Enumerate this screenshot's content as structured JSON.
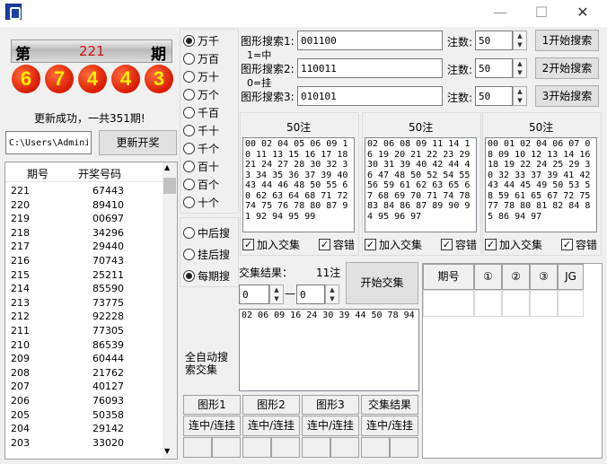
{
  "window": {
    "minimize": "—",
    "maximize": "☐",
    "close": "✕"
  },
  "header": {
    "prefix": "第",
    "issue": "221",
    "suffix": "期"
  },
  "balls": [
    "6",
    "7",
    "4",
    "4",
    "3"
  ],
  "update_status": "更新成功，一共351期!",
  "path_value": "C:\\Users\\Admini:",
  "update_button": "更新开奖",
  "history": {
    "headers": [
      "期号",
      "开奖号码"
    ],
    "rows": [
      [
        "221",
        "67443"
      ],
      [
        "220",
        "89410"
      ],
      [
        "219",
        "00697"
      ],
      [
        "218",
        "34296"
      ],
      [
        "217",
        "29440"
      ],
      [
        "216",
        "70743"
      ],
      [
        "215",
        "25211"
      ],
      [
        "214",
        "85590"
      ],
      [
        "213",
        "73775"
      ],
      [
        "212",
        "92228"
      ],
      [
        "211",
        "77305"
      ],
      [
        "210",
        "86539"
      ],
      [
        "209",
        "60444"
      ],
      [
        "208",
        "21762"
      ],
      [
        "207",
        "40127"
      ],
      [
        "206",
        "76093"
      ],
      [
        "205",
        "50358"
      ],
      [
        "204",
        "29142"
      ],
      [
        "203",
        "33020"
      ]
    ]
  },
  "positions": {
    "options": [
      "万千",
      "万百",
      "万十",
      "万个",
      "千百",
      "千十",
      "千个",
      "百十",
      "百个",
      "十个"
    ],
    "selected": 0
  },
  "search_mode": {
    "options": [
      "中后搜",
      "挂后搜",
      "每期搜"
    ],
    "selected": 2
  },
  "patterns": [
    {
      "label": "图形搜索1:",
      "value": "001100",
      "count_label": "注数:",
      "count": "50",
      "button": "1开始搜索"
    },
    {
      "label": "图形搜索2:",
      "value": "110011",
      "count_label": "注数:",
      "count": "50",
      "button": "2开始搜索"
    },
    {
      "label": "图形搜索3:",
      "value": "010101",
      "count_label": "注数:",
      "count": "50",
      "button": "3开始搜索"
    }
  ],
  "legend": {
    "hit": "1=中",
    "miss": "0=挂"
  },
  "results": [
    {
      "title": "50注",
      "numbers": "00 02 04 05 06 09 10 11 13 15 16 17 18 21 24 27 28 30 32 33 34 35 36 37 39 40 43 44 46 48 50 55 60 62 63 64 68 71 72 74 75 76 78 80 87 91 92 94 95 99",
      "add": "加入交集",
      "tolerance": "容错"
    },
    {
      "title": "50注",
      "numbers": "02 06 08 09 11 14 16 19 20 21 22 23 29 30 31 39 40 42 44 46 47 48 50 52 54 55 56 59 61 62 63 65 67 68 69 70 71 74 78 83 84 86 87 89 90 94 95 96 97",
      "add": "加入交集",
      "tolerance": "容错"
    },
    {
      "title": "50注",
      "numbers": "00 01 02 04 06 07 08 09 10 12 13 14 16 18 19 22 24 25 29 30 32 33 37 39 41 42 43 44 45 49 50 53 58 59 61 65 67 72 75 77 78 80 81 82 84 85 86 94 97",
      "add": "加入交集",
      "tolerance": "容错"
    }
  ],
  "intersection": {
    "label": "交集结果：",
    "count": "11注",
    "button": "开始交集",
    "from": "0",
    "to": "0",
    "dash": "—",
    "result": "02 06 09 16 24 30 39 44 50 78 94",
    "auto_label": "全自动搜索交集"
  },
  "stats_headers": [
    "图形1",
    "图形2",
    "图形3",
    "交集结果"
  ],
  "stats_sub": "连中/连挂",
  "result_table": {
    "headers": [
      "期号",
      "①",
      "②",
      "③",
      "JG"
    ]
  }
}
